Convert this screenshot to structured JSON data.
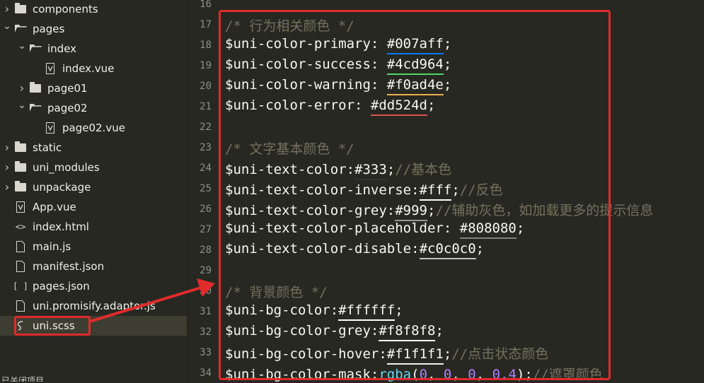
{
  "sidebar": {
    "items": [
      {
        "label": "components",
        "kind": "folder",
        "expanded": false,
        "depth": 0
      },
      {
        "label": "pages",
        "kind": "folder",
        "expanded": true,
        "depth": 0
      },
      {
        "label": "index",
        "kind": "folder",
        "expanded": true,
        "depth": 1
      },
      {
        "label": "index.vue",
        "kind": "vue",
        "depth": 2
      },
      {
        "label": "page01",
        "kind": "folder",
        "expanded": false,
        "depth": 1
      },
      {
        "label": "page02",
        "kind": "folder",
        "expanded": true,
        "depth": 1
      },
      {
        "label": "page02.vue",
        "kind": "vue",
        "depth": 2
      },
      {
        "label": "static",
        "kind": "folder",
        "expanded": false,
        "depth": 0
      },
      {
        "label": "uni_modules",
        "kind": "folder",
        "expanded": false,
        "depth": 0
      },
      {
        "label": "unpackage",
        "kind": "folder",
        "expanded": false,
        "depth": 0
      },
      {
        "label": "App.vue",
        "kind": "vue",
        "depth": 0
      },
      {
        "label": "index.html",
        "kind": "html",
        "depth": 0
      },
      {
        "label": "main.js",
        "kind": "file",
        "depth": 0
      },
      {
        "label": "manifest.json",
        "kind": "json-file",
        "depth": 0
      },
      {
        "label": "pages.json",
        "kind": "json",
        "depth": 0
      },
      {
        "label": "uni.promisify.adaptor.js",
        "kind": "file",
        "depth": 0
      },
      {
        "label": "uni.scss",
        "kind": "scss",
        "depth": 0,
        "selected": true
      }
    ],
    "bottom_text": "已关闭项目"
  },
  "editor": {
    "lines": [
      {
        "n": "16",
        "segs": []
      },
      {
        "n": "17",
        "segs": [
          {
            "t": "comment",
            "v": "/* 行为相关颜色 */"
          }
        ]
      },
      {
        "n": "18",
        "segs": [
          {
            "t": "var",
            "v": "$uni-color-primary"
          },
          {
            "t": "punc",
            "v": ": "
          },
          {
            "t": "value",
            "v": "#007aff",
            "u": "#007aff"
          },
          {
            "t": "punc",
            "v": ";"
          }
        ]
      },
      {
        "n": "19",
        "segs": [
          {
            "t": "var",
            "v": "$uni-color-success"
          },
          {
            "t": "punc",
            "v": ": "
          },
          {
            "t": "value",
            "v": "#4cd964",
            "u": "#4cd964"
          },
          {
            "t": "punc",
            "v": ";"
          }
        ]
      },
      {
        "n": "20",
        "segs": [
          {
            "t": "var",
            "v": "$uni-color-warning"
          },
          {
            "t": "punc",
            "v": ": "
          },
          {
            "t": "value",
            "v": "#f0ad4e",
            "u": "#f0ad4e"
          },
          {
            "t": "punc",
            "v": ";"
          }
        ]
      },
      {
        "n": "21",
        "segs": [
          {
            "t": "var",
            "v": "$uni-color-error"
          },
          {
            "t": "punc",
            "v": ": "
          },
          {
            "t": "value",
            "v": "#dd524d",
            "u": "#dd524d"
          },
          {
            "t": "punc",
            "v": ";"
          }
        ]
      },
      {
        "n": "22",
        "segs": []
      },
      {
        "n": "23",
        "segs": [
          {
            "t": "comment",
            "v": "/* 文字基本颜色 */"
          }
        ]
      },
      {
        "n": "24",
        "segs": [
          {
            "t": "var",
            "v": "$uni-text-color"
          },
          {
            "t": "punc",
            "v": ":"
          },
          {
            "t": "value",
            "v": "#333",
            "u": "#333333"
          },
          {
            "t": "punc",
            "v": ";"
          },
          {
            "t": "comment",
            "v": "//基本色"
          }
        ]
      },
      {
        "n": "25",
        "segs": [
          {
            "t": "var",
            "v": "$uni-text-color-inverse"
          },
          {
            "t": "punc",
            "v": ":"
          },
          {
            "t": "value",
            "v": "#fff",
            "u": "#ffffff"
          },
          {
            "t": "punc",
            "v": ";"
          },
          {
            "t": "comment",
            "v": "//反色"
          }
        ]
      },
      {
        "n": "26",
        "segs": [
          {
            "t": "var",
            "v": "$uni-text-color-grey"
          },
          {
            "t": "punc",
            "v": ":"
          },
          {
            "t": "value",
            "v": "#999",
            "u": "#999999"
          },
          {
            "t": "punc",
            "v": ";"
          },
          {
            "t": "comment",
            "v": "//辅助灰色，如加载更多的提示信息"
          }
        ]
      },
      {
        "n": "27",
        "segs": [
          {
            "t": "var",
            "v": "$uni-text-color-placeholder"
          },
          {
            "t": "punc",
            "v": ": "
          },
          {
            "t": "value",
            "v": "#808080",
            "u": "#808080"
          },
          {
            "t": "punc",
            "v": ";"
          }
        ]
      },
      {
        "n": "28",
        "segs": [
          {
            "t": "var",
            "v": "$uni-text-color-disable"
          },
          {
            "t": "punc",
            "v": ":"
          },
          {
            "t": "value",
            "v": "#c0c0c0",
            "u": "#c0c0c0"
          },
          {
            "t": "punc",
            "v": ";"
          }
        ]
      },
      {
        "n": "29",
        "segs": []
      },
      {
        "n": "30",
        "segs": [
          {
            "t": "comment",
            "v": "/* 背景颜色 */"
          }
        ]
      },
      {
        "n": "31",
        "segs": [
          {
            "t": "var",
            "v": "$uni-bg-color"
          },
          {
            "t": "punc",
            "v": ":"
          },
          {
            "t": "value",
            "v": "#ffffff",
            "u": "#ffffff"
          },
          {
            "t": "punc",
            "v": ";"
          }
        ]
      },
      {
        "n": "32",
        "segs": [
          {
            "t": "var",
            "v": "$uni-bg-color-grey"
          },
          {
            "t": "punc",
            "v": ":"
          },
          {
            "t": "value",
            "v": "#f8f8f8",
            "u": "#f8f8f8"
          },
          {
            "t": "punc",
            "v": ";"
          }
        ]
      },
      {
        "n": "33",
        "segs": [
          {
            "t": "var",
            "v": "$uni-bg-color-hover"
          },
          {
            "t": "punc",
            "v": ":"
          },
          {
            "t": "value",
            "v": "#f1f1f1",
            "u": "#f1f1f1"
          },
          {
            "t": "punc",
            "v": ";"
          },
          {
            "t": "comment",
            "v": "//点击状态颜色"
          }
        ]
      },
      {
        "n": "34",
        "segs": [
          {
            "t": "var",
            "v": "$uni-bg-color-mask"
          },
          {
            "t": "punc",
            "v": ":"
          },
          {
            "t": "fn",
            "v": "rgba"
          },
          {
            "t": "punc",
            "v": "("
          },
          {
            "t": "num",
            "v": "0"
          },
          {
            "t": "punc",
            "v": ", "
          },
          {
            "t": "num",
            "v": "0"
          },
          {
            "t": "punc",
            "v": ", "
          },
          {
            "t": "num",
            "v": "0"
          },
          {
            "t": "punc",
            "v": ", "
          },
          {
            "t": "num",
            "v": "0.4"
          },
          {
            "t": "punc",
            "v": ");"
          },
          {
            "t": "comment",
            "v": "//遮罩颜色"
          }
        ]
      }
    ]
  },
  "colors": {
    "highlight": "#e02b2b",
    "background": "#272822"
  }
}
